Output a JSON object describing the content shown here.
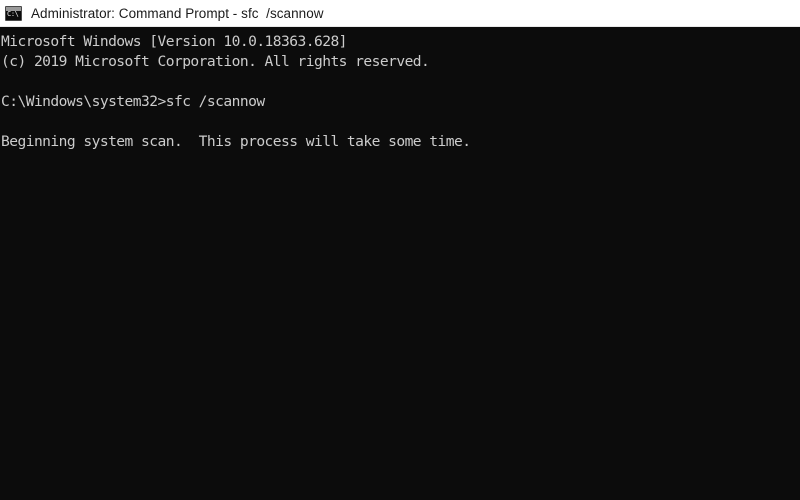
{
  "window": {
    "title": "Administrator: Command Prompt - sfc  /scannow",
    "icon_name": "command-prompt-icon",
    "icon_glyph": "C:\\.",
    "titlebar_bg": "#ffffff",
    "titlebar_text_color": "#1b1b1b"
  },
  "console": {
    "background_color": "#0c0c0c",
    "text_color": "#cccccc",
    "lines": [
      "Microsoft Windows [Version 10.0.18363.628]",
      "(c) 2019 Microsoft Corporation. All rights reserved.",
      "",
      "C:\\Windows\\system32>sfc /scannow",
      "",
      "Beginning system scan.  This process will take some time.",
      "",
      "",
      "",
      "",
      "",
      "",
      "",
      "",
      "",
      "",
      "",
      "",
      "",
      "",
      "",
      "",
      ""
    ]
  },
  "watermark": {
    "text": ""
  }
}
